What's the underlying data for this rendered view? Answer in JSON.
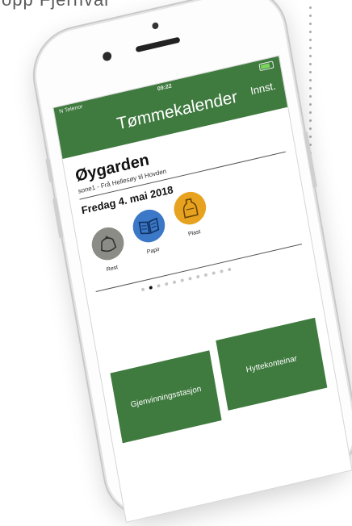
{
  "page": {
    "heading": "opp Fjernvar"
  },
  "status_bar": {
    "carrier": "N Telenor",
    "time": "09:22"
  },
  "app": {
    "title": "Tømmekalender",
    "settings_label": "Innst."
  },
  "location": {
    "name": "Øygarden",
    "zone": "sone1 - Frå Hellesøy til Hovden"
  },
  "pickup": {
    "date": "Fredag 4. mai 2018",
    "bins": [
      {
        "label": "Rest",
        "color": "#8c8c86",
        "icon": "trash-bag-icon"
      },
      {
        "label": "Papir",
        "color": "#3b78c8",
        "icon": "book-icon"
      },
      {
        "label": "Plast",
        "color": "#e7a21f",
        "icon": "plastic-bottle-icon"
      }
    ]
  },
  "pager": {
    "total_pages": 12,
    "active_index": 1
  },
  "buttons": {
    "recycling_station": "Gjenvinningsstasjon",
    "cabin_container": "Hyttekonteinar"
  },
  "colors": {
    "brand_green": "#3f7a3f"
  }
}
